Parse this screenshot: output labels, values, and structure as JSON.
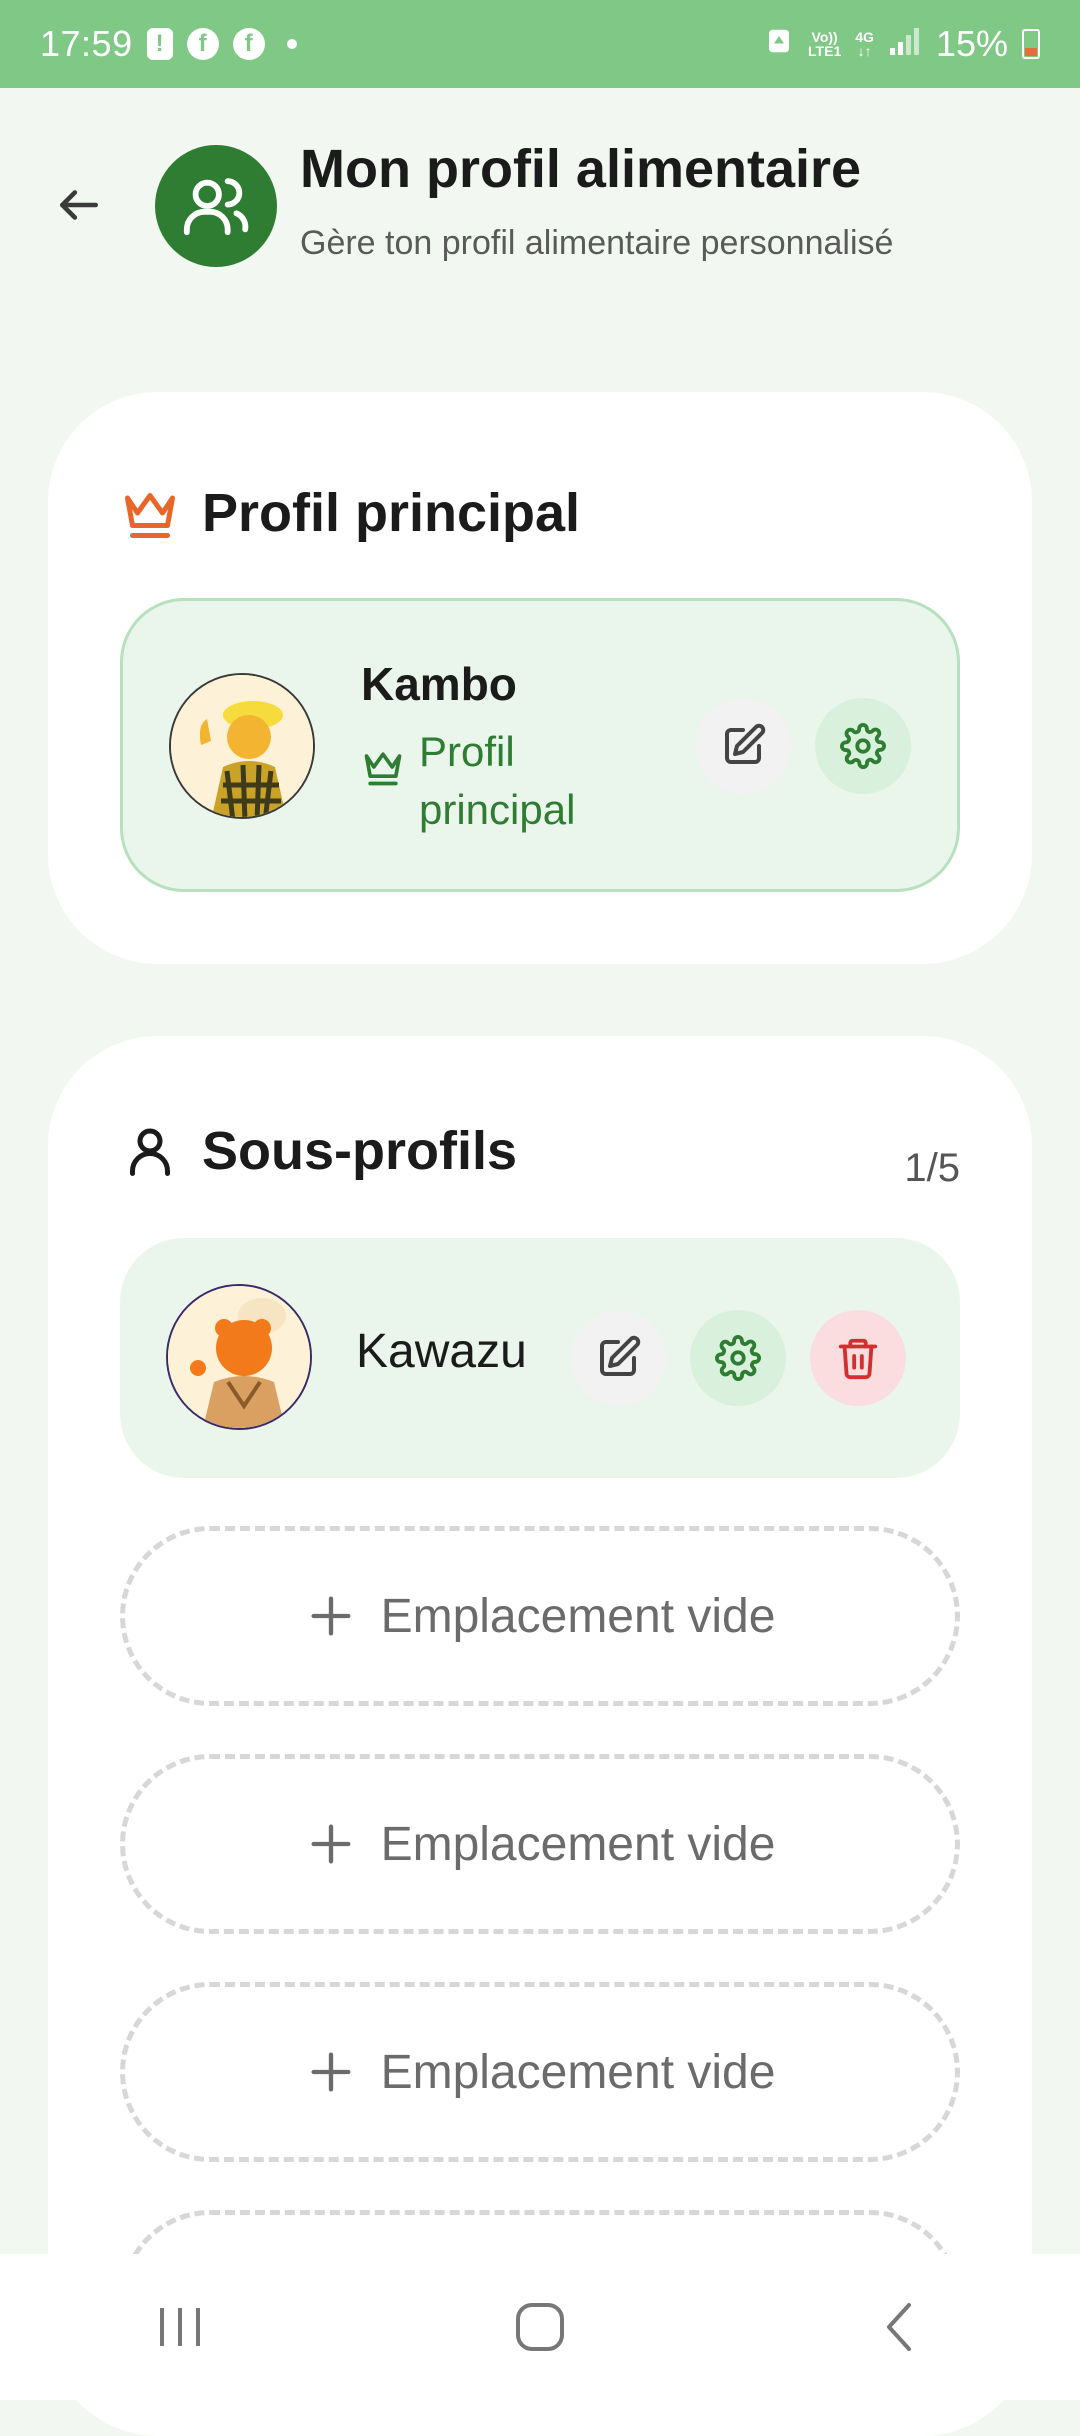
{
  "status_bar": {
    "time": "17:59",
    "network_top": "Vo))",
    "network_bottom": "LTE1",
    "network_type": "4G",
    "battery": "15%"
  },
  "header": {
    "title": "Mon profil alimentaire",
    "subtitle": "Gère ton profil alimentaire personnalisé"
  },
  "main_profile": {
    "section_title": "Profil principal",
    "name": "Kambo",
    "badge_label": "Profil principal"
  },
  "sub_profiles": {
    "section_title": "Sous-profils",
    "count": "1/5",
    "items": [
      {
        "name": "Kawazu"
      }
    ],
    "empty_label": "Emplacement vide"
  },
  "colors": {
    "accent": "#2e7d32",
    "status_bar": "#80c886",
    "crown": "#e8662a",
    "delete": "#d32f2f"
  }
}
